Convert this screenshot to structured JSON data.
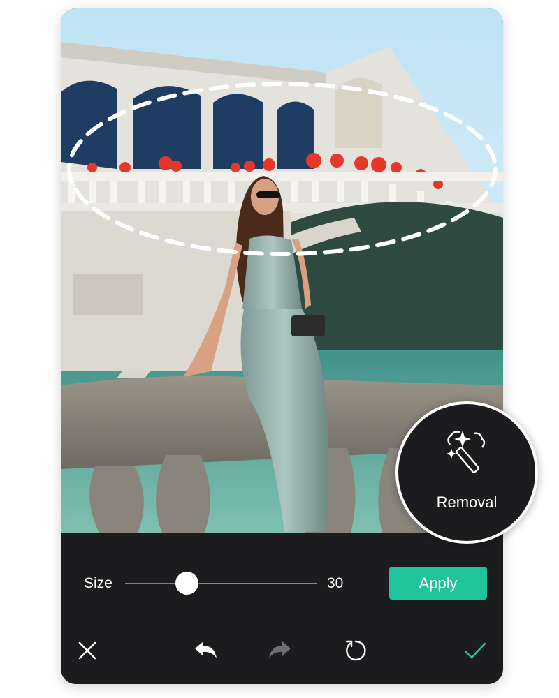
{
  "editor": {
    "size_label": "Size",
    "size_value": "30",
    "slider_level_percent": 32,
    "apply_label": "Apply"
  },
  "toolbar": {
    "icons": [
      "close-icon",
      "undo-icon",
      "redo-icon",
      "reset-icon",
      "confirm-icon"
    ]
  },
  "tool_badge": {
    "label": "Removal",
    "icon": "magic-wand-icon"
  },
  "colors": {
    "panel_bg": "#1c1c1e",
    "accent_green": "#1fc49b",
    "slider_fill": "#e2556b",
    "confirm_check": "#1fc49b",
    "disabled_icon": "#6e6e73"
  }
}
